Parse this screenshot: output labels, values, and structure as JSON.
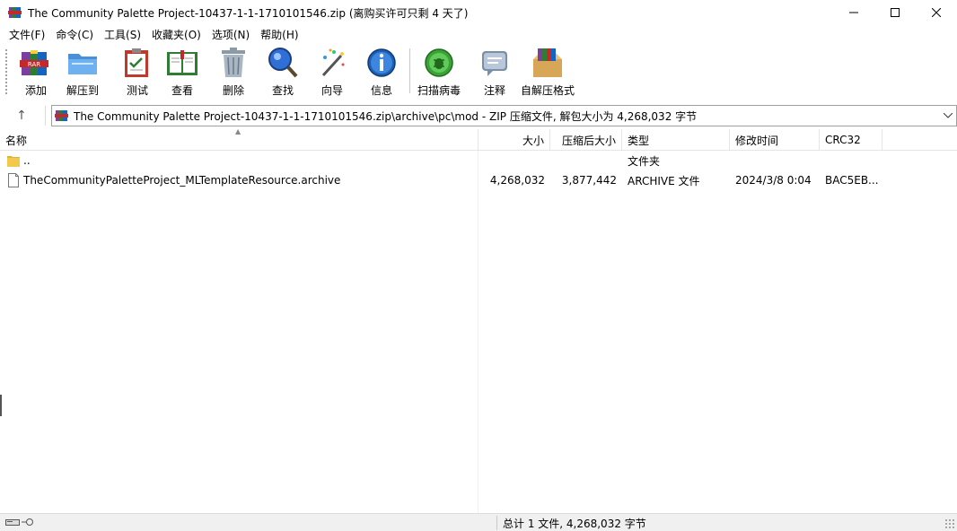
{
  "window": {
    "title": "The Community Palette Project-10437-1-1-1710101546.zip (离购买许可只剩 4 天了)",
    "controls": {
      "minimize": "—",
      "maximize": "☐",
      "close": "✕"
    }
  },
  "menu": {
    "items": [
      "文件(F)",
      "命令(C)",
      "工具(S)",
      "收藏夹(O)",
      "选项(N)",
      "帮助(H)"
    ]
  },
  "toolbar": {
    "buttons": [
      {
        "label": "添加",
        "icon": "add-archive-icon"
      },
      {
        "label": "解压到",
        "icon": "extract-folder-icon"
      },
      {
        "label": "测试",
        "icon": "test-clipboard-icon"
      },
      {
        "label": "查看",
        "icon": "view-book-icon"
      },
      {
        "label": "删除",
        "icon": "trash-icon"
      },
      {
        "label": "查找",
        "icon": "magnifier-icon"
      },
      {
        "label": "向导",
        "icon": "wizard-wand-icon"
      },
      {
        "label": "信息",
        "icon": "info-icon"
      },
      {
        "label": "扫描病毒",
        "icon": "virus-scan-icon"
      },
      {
        "label": "注释",
        "icon": "comment-icon"
      },
      {
        "label": "自解压格式",
        "icon": "sfx-box-icon"
      }
    ]
  },
  "address": {
    "up_label": "↑",
    "path": "The Community Palette Project-10437-1-1-1710101546.zip\\archive\\pc\\mod - ZIP 压缩文件, 解包大小为 4,268,032 字节"
  },
  "columns": {
    "name": "名称",
    "size": "大小",
    "packed": "压缩后大小",
    "type": "类型",
    "modified": "修改时间",
    "crc": "CRC32"
  },
  "files": [
    {
      "name": "..",
      "size": "",
      "packed": "",
      "type": "文件夹",
      "modified": "",
      "crc": ""
    },
    {
      "name": "TheCommunityPaletteProject_MLTemplateResource.archive",
      "size": "4,268,032",
      "packed": "3,877,442",
      "type": "ARCHIVE 文件",
      "modified": "2024/3/8 0:04",
      "crc": "BAC5EB..."
    }
  ],
  "status": {
    "summary": "总计 1 文件, 4,268,032 字节"
  },
  "colors": {
    "folder": "#f2c94c",
    "winrar_red": "#b22222",
    "info_blue": "#1e5fb4",
    "scan_green": "#3aa335"
  }
}
